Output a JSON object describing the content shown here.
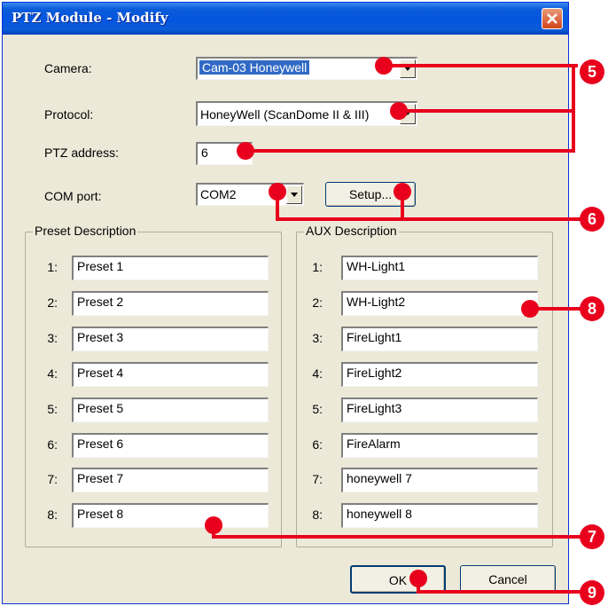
{
  "window": {
    "title": "PTZ Module - Modify"
  },
  "form": {
    "camera_label": "Camera:",
    "camera_value": "Cam-03 Honeywell",
    "protocol_label": "Protocol:",
    "protocol_value": "HoneyWell (ScanDome II & III)",
    "address_label": "PTZ address:",
    "address_value": "6",
    "com_label": "COM port:",
    "com_value": "COM2",
    "setup_label": "Setup..."
  },
  "preset": {
    "title": "Preset Description",
    "items": [
      {
        "num": "1:",
        "value": "Preset 1"
      },
      {
        "num": "2:",
        "value": "Preset 2"
      },
      {
        "num": "3:",
        "value": "Preset 3"
      },
      {
        "num": "4:",
        "value": "Preset 4"
      },
      {
        "num": "5:",
        "value": "Preset 5"
      },
      {
        "num": "6:",
        "value": "Preset 6"
      },
      {
        "num": "7:",
        "value": "Preset 7"
      },
      {
        "num": "8:",
        "value": "Preset 8"
      }
    ]
  },
  "aux": {
    "title": "AUX Description",
    "items": [
      {
        "num": "1:",
        "value": "WH-Light1"
      },
      {
        "num": "2:",
        "value": "WH-Light2"
      },
      {
        "num": "3:",
        "value": "FireLight1"
      },
      {
        "num": "4:",
        "value": "FireLight2"
      },
      {
        "num": "5:",
        "value": "FireLight3"
      },
      {
        "num": "6:",
        "value": "FireAlarm"
      },
      {
        "num": "7:",
        "value": "honeywell 7"
      },
      {
        "num": "8:",
        "value": "honeywell 8"
      }
    ]
  },
  "buttons": {
    "ok": "OK",
    "cancel": "Cancel"
  },
  "callouts": {
    "c5": "5",
    "c6": "6",
    "c7": "7",
    "c8": "8",
    "c9": "9"
  },
  "colors": {
    "annotation": "#e8001c",
    "titlebar": "#0455e0",
    "dialog_bg": "#ece9d8",
    "selection": "#316ac5"
  },
  "icons": {
    "close": "close-icon",
    "dropdown": "chevron-down-icon"
  }
}
